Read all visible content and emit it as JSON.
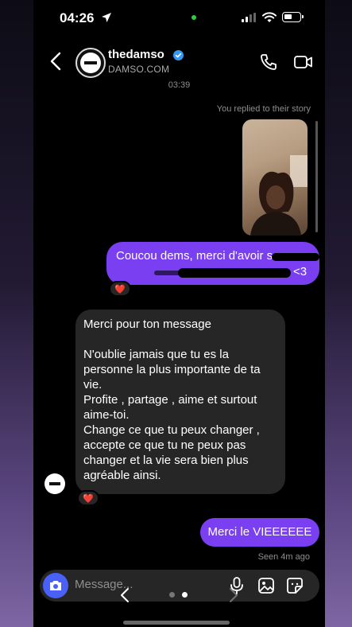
{
  "status_bar": {
    "time": "04:26"
  },
  "header": {
    "username": "thedamso",
    "subtitle": "DAMSO.COM"
  },
  "thread": {
    "timestamp": "03:39",
    "story_reply_caption": "You replied to their story",
    "messages": [
      {
        "from": "me",
        "text_visible_start": "Coucou dems, merci d'avoir s",
        "text_visible_end": "<3",
        "reaction": "❤️"
      },
      {
        "from": "them",
        "lines": [
          "Merci pour ton message",
          "",
          "N'oublie jamais que tu es la personne la plus importante de ta vie.",
          "Profite , partage , aime et surtout aime-toi.",
          "Change ce que tu peux changer , accepte ce que tu ne peux pas changer et la vie sera bien plus agréable ainsi."
        ],
        "reaction": "❤️"
      },
      {
        "from": "me",
        "text": "Merci le VIEEEEEE"
      }
    ],
    "seen_status": "Seen 4m ago"
  },
  "composer": {
    "placeholder": "Message..."
  },
  "colors": {
    "sent_bubble": "#7b3ff2",
    "received_bubble": "#262626",
    "camera_button": "#4a61f7",
    "verified_badge": "#3897f0"
  },
  "icons": [
    "back-icon",
    "verified-icon",
    "phone-icon",
    "video-icon",
    "camera-icon",
    "mic-icon",
    "gallery-icon",
    "sticker-icon",
    "location-arrow-icon",
    "signal-icon",
    "wifi-icon",
    "battery-icon"
  ]
}
